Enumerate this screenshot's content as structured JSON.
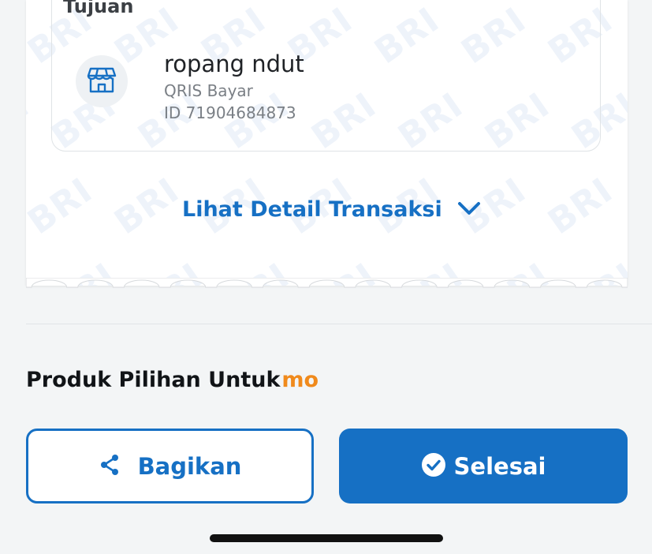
{
  "destination": {
    "section_title": "Tujuan",
    "merchant_name": "ropang ndut",
    "payment_type": "QRIS Bayar",
    "merchant_id": "ID 71904684873",
    "merchant_icon": "store-icon"
  },
  "watermark_text": "BRI",
  "detail_link": {
    "label": "Lihat Detail Transaksi",
    "icon": "chevron-down-icon"
  },
  "products_section": {
    "title": "Produk Pilihan Untuk",
    "brand_suffix": "mo"
  },
  "actions": {
    "share_label": "Bagikan",
    "share_icon": "share-icon",
    "done_label": "Selesai",
    "done_icon": "check-circle-icon"
  },
  "colors": {
    "accent": "#1670c4",
    "brand_orange": "#f08a1c",
    "background": "#f3f5f6"
  }
}
